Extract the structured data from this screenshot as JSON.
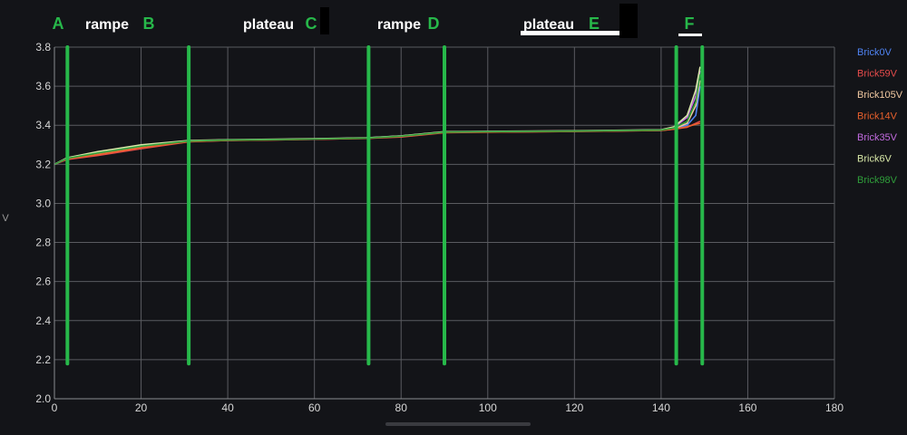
{
  "chart_data": {
    "type": "line",
    "xlabel": "",
    "ylabel": "V",
    "xlim": [
      0,
      180
    ],
    "ylim": [
      2.0,
      3.8
    ],
    "xticks": [
      0,
      20,
      40,
      60,
      80,
      100,
      120,
      140,
      160,
      180
    ],
    "yticks": [
      2.0,
      2.2,
      2.4,
      2.6,
      2.8,
      3.0,
      3.2,
      3.4,
      3.6,
      3.8
    ],
    "grid": true,
    "legend_position": "right",
    "series": [
      {
        "name": "Brick0V",
        "color": "#4f83f2",
        "x": [
          0,
          3,
          10,
          20,
          31,
          40,
          50,
          60,
          72,
          80,
          90,
          100,
          120,
          140,
          143,
          146,
          148,
          149
        ],
        "y": [
          3.2,
          3.23,
          3.26,
          3.295,
          3.32,
          3.325,
          3.327,
          3.33,
          3.335,
          3.345,
          3.365,
          3.367,
          3.37,
          3.375,
          3.385,
          3.4,
          3.45,
          3.6
        ]
      },
      {
        "name": "Brick59V",
        "color": "#e54b4b",
        "x": [
          0,
          3,
          10,
          20,
          31,
          40,
          50,
          60,
          72,
          80,
          90,
          100,
          120,
          140,
          143,
          146,
          148,
          149
        ],
        "y": [
          3.2,
          3.225,
          3.245,
          3.28,
          3.315,
          3.322,
          3.325,
          3.328,
          3.333,
          3.34,
          3.362,
          3.365,
          3.368,
          3.373,
          3.38,
          3.39,
          3.41,
          3.42
        ]
      },
      {
        "name": "Brick105V",
        "color": "#f0c8a0",
        "x": [
          0,
          3,
          10,
          20,
          31,
          40,
          50,
          60,
          72,
          80,
          90,
          100,
          120,
          140,
          143,
          146,
          148,
          149
        ],
        "y": [
          3.2,
          3.23,
          3.255,
          3.29,
          3.318,
          3.323,
          3.326,
          3.329,
          3.334,
          3.343,
          3.364,
          3.366,
          3.369,
          3.374,
          3.383,
          3.41,
          3.5,
          3.63
        ]
      },
      {
        "name": "Brick14V",
        "color": "#e8602c",
        "x": [
          0,
          3,
          10,
          20,
          31,
          40,
          50,
          60,
          72,
          80,
          90,
          100,
          120,
          140,
          143,
          146,
          148,
          149
        ],
        "y": [
          3.2,
          3.228,
          3.25,
          3.285,
          3.316,
          3.322,
          3.325,
          3.328,
          3.333,
          3.342,
          3.363,
          3.365,
          3.368,
          3.373,
          3.38,
          3.392,
          3.405,
          3.41
        ]
      },
      {
        "name": "Brick35V",
        "color": "#c26be0",
        "x": [
          0,
          3,
          10,
          20,
          31,
          40,
          50,
          60,
          72,
          80,
          90,
          100,
          120,
          140,
          143,
          146,
          148,
          149
        ],
        "y": [
          3.2,
          3.232,
          3.26,
          3.297,
          3.32,
          3.325,
          3.327,
          3.33,
          3.335,
          3.345,
          3.366,
          3.368,
          3.371,
          3.376,
          3.39,
          3.44,
          3.55,
          3.68
        ]
      },
      {
        "name": "Brick6V",
        "color": "#d8e8a8",
        "x": [
          0,
          3,
          10,
          20,
          31,
          40,
          50,
          60,
          72,
          80,
          90,
          100,
          120,
          140,
          143,
          146,
          148,
          149
        ],
        "y": [
          3.2,
          3.234,
          3.265,
          3.3,
          3.322,
          3.326,
          3.328,
          3.331,
          3.336,
          3.346,
          3.367,
          3.369,
          3.372,
          3.377,
          3.392,
          3.45,
          3.58,
          3.7
        ]
      },
      {
        "name": "Brick98V",
        "color": "#2f9e3a",
        "x": [
          0,
          3,
          10,
          20,
          31,
          40,
          50,
          60,
          72,
          80,
          90,
          100,
          120,
          140,
          143,
          146,
          148,
          149
        ],
        "y": [
          3.2,
          3.231,
          3.258,
          3.293,
          3.319,
          3.324,
          3.326,
          3.329,
          3.334,
          3.344,
          3.365,
          3.367,
          3.37,
          3.375,
          3.386,
          3.42,
          3.52,
          3.66
        ]
      }
    ],
    "markers": {
      "color": "#27b84a",
      "y_top": 3.8,
      "y_bottom": 2.18,
      "positions": [
        3,
        31,
        72.5,
        90,
        143.5,
        149.5
      ]
    },
    "annotations": [
      {
        "text": "A",
        "color": "#27b84a"
      },
      {
        "text": "rampe",
        "color": "#ffffff"
      },
      {
        "text": "B",
        "color": "#27b84a"
      },
      {
        "text": "plateau",
        "color": "#ffffff"
      },
      {
        "text": "C",
        "color": "#27b84a"
      },
      {
        "text": "rampe",
        "color": "#ffffff"
      },
      {
        "text": "D",
        "color": "#27b84a"
      },
      {
        "text": "plateau",
        "color": "#ffffff"
      },
      {
        "text": "E",
        "color": "#27b84a"
      },
      {
        "text": "F",
        "color": "#27b84a"
      }
    ]
  }
}
